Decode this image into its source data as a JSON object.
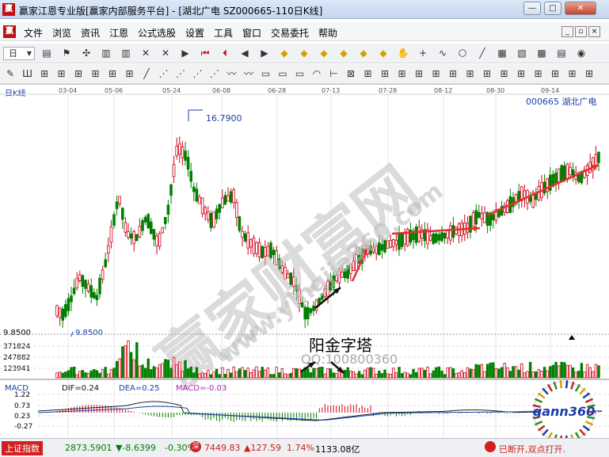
{
  "window": {
    "title": "赢家江恩专业版[赢家内部服务平台] - [湖北广电  SZ000665-110日K线]",
    "logo_text": "赢",
    "buttons": {
      "minimize": "—",
      "maximize": "□",
      "close": "✕"
    }
  },
  "menu": {
    "logo_text": "赢",
    "items": [
      "文件",
      "浏览",
      "资讯",
      "江恩",
      "公式选股",
      "设置",
      "工具",
      "窗口",
      "交易委托",
      "帮助"
    ],
    "mdi_buttons": [
      "_",
      "▫",
      "×"
    ]
  },
  "toolbar1": {
    "period_label": "日",
    "icons": [
      "stats-icon",
      "flag-icon",
      "pinwheel-icon",
      "bars-icon",
      "bars-icon",
      "cross-icon",
      "cross-icon",
      "arrow-flag-icon",
      "first-icon",
      "prev-icon",
      "back-icon",
      "forward-icon",
      "diamond-icon",
      "diamond-icon",
      "diamond-icon",
      "diamond-icon",
      "diamond-icon",
      "diamond-icon",
      "hand-icon",
      "crosshair-icon",
      "curve-icon",
      "hex-icon",
      "line-icon",
      "calendar-icon",
      "mini-chart-icon",
      "grid-icon",
      "ticker-icon",
      "bulb-icon"
    ]
  },
  "toolbar2": {
    "icons": [
      "draw-icon",
      "trident-icon",
      "tool-icon",
      "tool-icon",
      "tool-icon",
      "tool-icon",
      "tool-icon",
      "tool-icon",
      "line-tool-icon",
      "fan-icon",
      "fan-icon",
      "fan-icon",
      "fan-icon",
      "wave-icon",
      "wave-icon",
      "box-icon",
      "box-icon",
      "box-icon",
      "arc-icon",
      "ruler-icon",
      "gann-box-icon",
      "tool-icon",
      "tool-icon",
      "tool-icon",
      "tool-icon",
      "tool-icon",
      "tool-icon",
      "tool-icon",
      "tool-icon",
      "tool-icon",
      "tool-icon",
      "tool-icon",
      "tool-icon",
      "tool-icon",
      "tool-icon"
    ]
  },
  "chart": {
    "period_label": "日K线",
    "stock_label": "000665  湖北广电",
    "date_ticks": [
      "03-04",
      "05-06",
      "05-24",
      "06-08",
      "06-28",
      "07-13",
      "07-28",
      "08-12",
      "08-30",
      "09-14"
    ],
    "high_label": "16.7900",
    "low_label": "9.8500",
    "left_price_label": "9.8500",
    "annotation": "阳金字塔",
    "watermark": "赢家财富网",
    "watermark_url": "www.yingjia360.com",
    "qq_text": "QQ:100800360",
    "volume_axis": [
      "371824",
      "247882",
      "123941"
    ],
    "macd": {
      "label": "MACD",
      "dif": "DIF=0.24",
      "dea": "DEA=0.25",
      "macd": "MACD=-0.03",
      "axis": [
        "1.22",
        "0.73",
        "0.23",
        "-0.27"
      ]
    },
    "badge": "gann360",
    "colors": {
      "up": "#d0021b",
      "down": "#008000",
      "arrow": "#e03030",
      "dif": "#222222",
      "dea": "#1e3fb0"
    }
  },
  "chart_data": {
    "type": "candlestick",
    "title": "000665 湖北广电 日K线",
    "ylim": [
      9.5,
      17.6
    ],
    "annotations": [
      "16.7900",
      "9.8500",
      "阳金字塔"
    ]
  },
  "status": {
    "index_label": "上证指数",
    "sh_value": "2873.5901",
    "sh_change": "▼-8.6399",
    "sh_pct": "-0.30%",
    "sz_value": "7449.83",
    "sz_change": "▲127.59",
    "sz_pct": "1.74%",
    "amount": "1133.08亿",
    "connection": "已断开,双点打开."
  }
}
